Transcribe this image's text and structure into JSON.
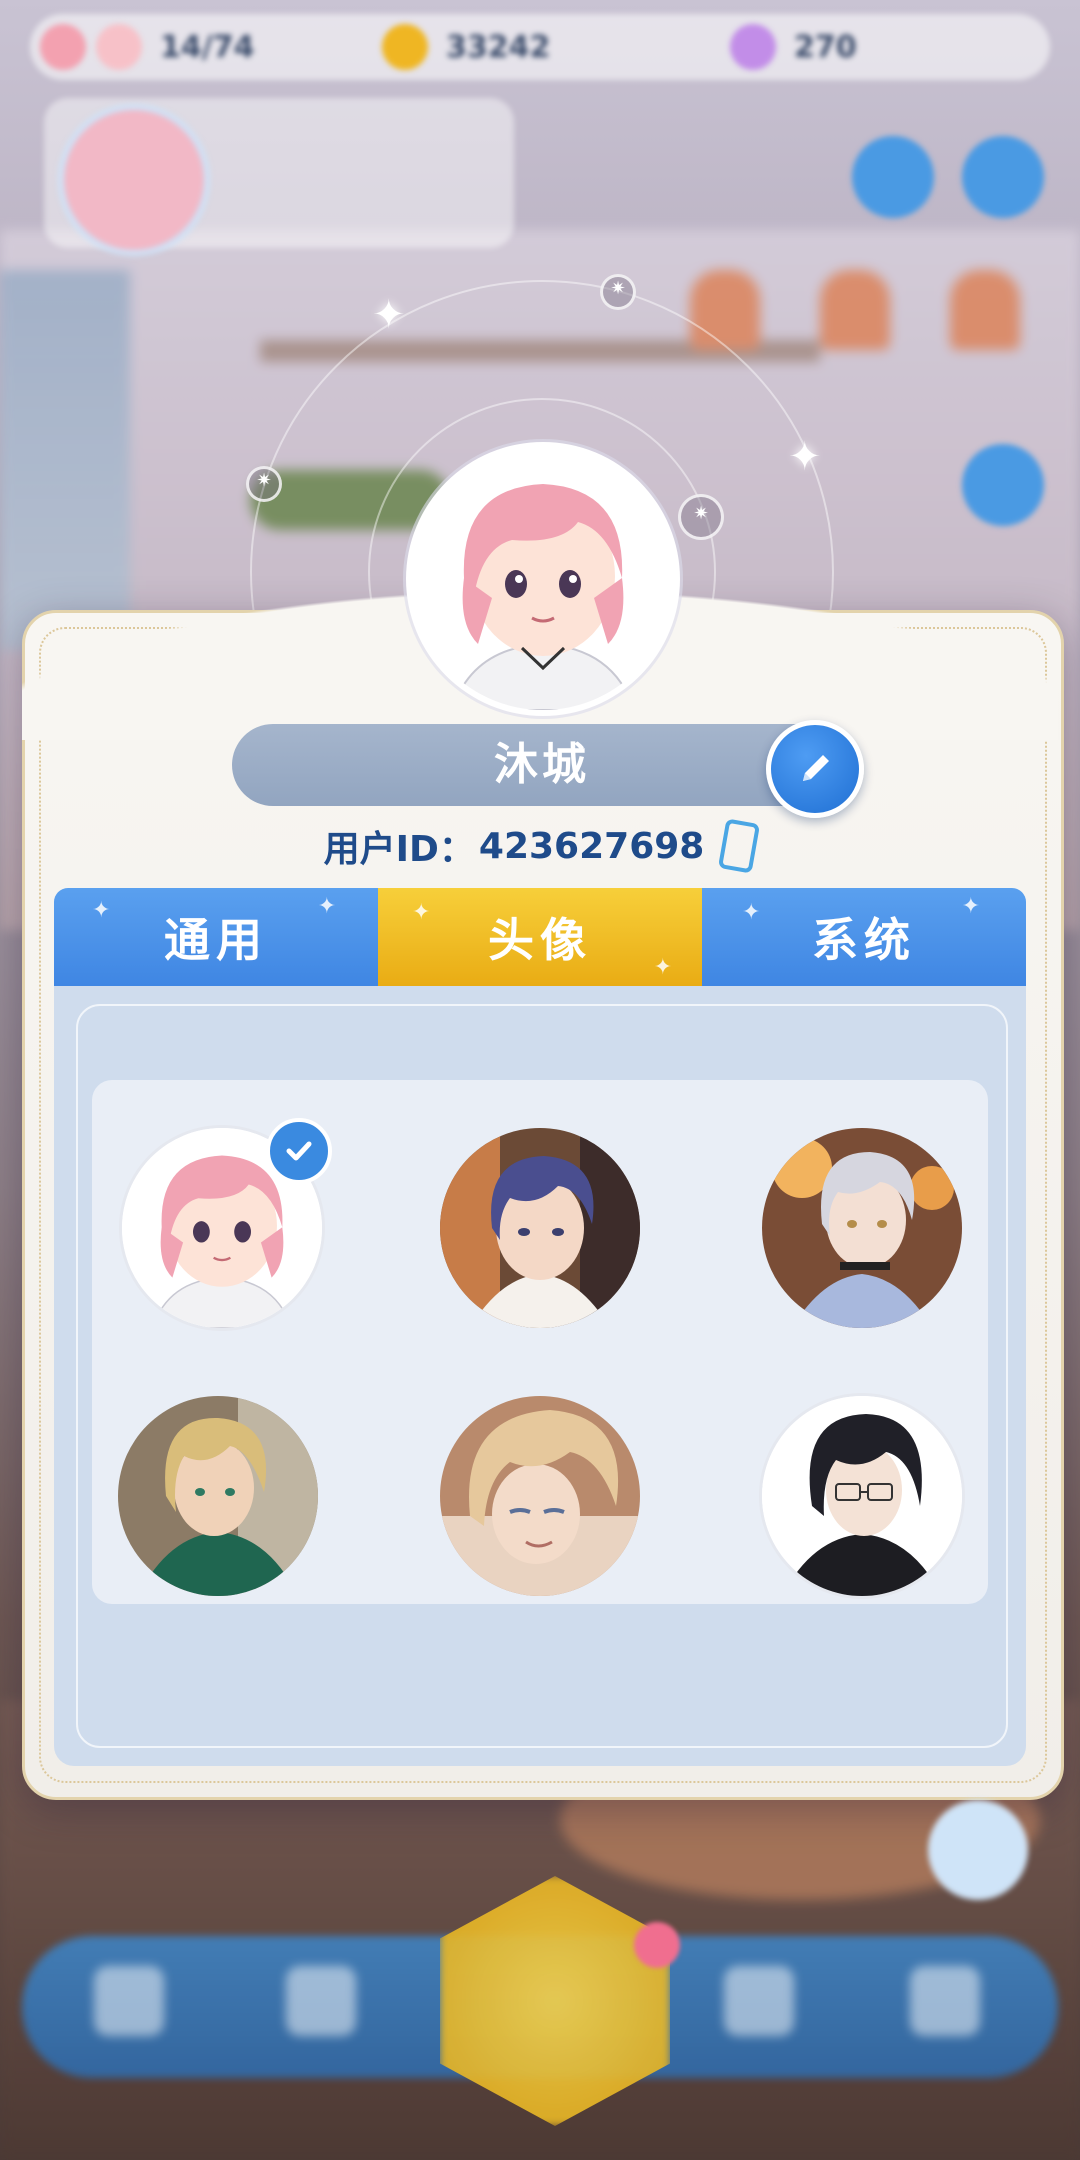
{
  "top_bar": {
    "stamina": "14/74",
    "coins": "33242",
    "gems": "270"
  },
  "profile": {
    "user_name": "沐城",
    "uid_label": "用户ID：",
    "uid_value": "423627698"
  },
  "tabs": [
    {
      "label": "通用",
      "active": false
    },
    {
      "label": "头像",
      "active": true
    },
    {
      "label": "系统",
      "active": false
    }
  ],
  "avatars": [
    {
      "name": "avatar-pink-hair-girl",
      "selected": true
    },
    {
      "name": "avatar-purple-hair-man",
      "selected": false
    },
    {
      "name": "avatar-silver-hair-man",
      "selected": false
    },
    {
      "name": "avatar-blonde-man-green-shirt",
      "selected": false
    },
    {
      "name": "avatar-blonde-man-smiling",
      "selected": false
    },
    {
      "name": "avatar-black-hair-glasses-man",
      "selected": false
    }
  ],
  "colors": {
    "tab_blue": "#4a90e6",
    "tab_active_yellow": "#f0bd26",
    "edit_button_blue": "#2a7ddd",
    "uid_text": "#1f4b8a"
  }
}
